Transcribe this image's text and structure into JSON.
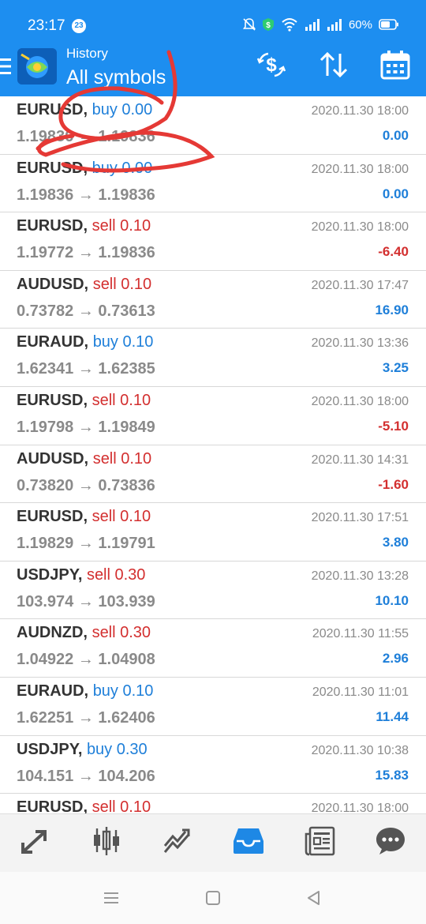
{
  "status_bar": {
    "time": "23:17",
    "notification_count": "23",
    "battery": "60%"
  },
  "header": {
    "subtitle": "History",
    "title": "All symbols",
    "icons": [
      "menu-icon",
      "app-logo",
      "currency-exchange-icon",
      "sort-icon",
      "calendar-icon"
    ]
  },
  "colors": {
    "appbar": "#1d8ef0",
    "buy": "#1e7fd9",
    "sell": "#d32f2f",
    "annotation": "#e53935"
  },
  "deals": [
    {
      "symbol": "EURUSD,",
      "side": "buy",
      "volume": "buy 0.00",
      "prices": "1.19836 → 1.19836",
      "time": "2020.11.30 18:00",
      "profit": "0.00",
      "sign": "pos"
    },
    {
      "symbol": "EURUSD,",
      "side": "buy",
      "volume": "buy 0.00",
      "prices": "1.19836 → 1.19836",
      "time": "2020.11.30 18:00",
      "profit": "0.00",
      "sign": "pos"
    },
    {
      "symbol": "EURUSD,",
      "side": "sell",
      "volume": "sell 0.10",
      "prices": "1.19772 → 1.19836",
      "time": "2020.11.30 18:00",
      "profit": "-6.40",
      "sign": "neg"
    },
    {
      "symbol": "AUDUSD,",
      "side": "sell",
      "volume": "sell 0.10",
      "prices": "0.73782 → 0.73613",
      "time": "2020.11.30 17:47",
      "profit": "16.90",
      "sign": "pos"
    },
    {
      "symbol": "EURAUD,",
      "side": "buy",
      "volume": "buy 0.10",
      "prices": "1.62341 → 1.62385",
      "time": "2020.11.30 13:36",
      "profit": "3.25",
      "sign": "pos"
    },
    {
      "symbol": "EURUSD,",
      "side": "sell",
      "volume": "sell 0.10",
      "prices": "1.19798 → 1.19849",
      "time": "2020.11.30 18:00",
      "profit": "-5.10",
      "sign": "neg"
    },
    {
      "symbol": "AUDUSD,",
      "side": "sell",
      "volume": "sell 0.10",
      "prices": "0.73820 → 0.73836",
      "time": "2020.11.30 14:31",
      "profit": "-1.60",
      "sign": "neg"
    },
    {
      "symbol": "EURUSD,",
      "side": "sell",
      "volume": "sell 0.10",
      "prices": "1.19829 → 1.19791",
      "time": "2020.11.30 17:51",
      "profit": "3.80",
      "sign": "pos"
    },
    {
      "symbol": "USDJPY,",
      "side": "sell",
      "volume": "sell 0.30",
      "prices": "103.974 → 103.939",
      "time": "2020.11.30 13:28",
      "profit": "10.10",
      "sign": "pos"
    },
    {
      "symbol": "AUDNZD,",
      "side": "sell",
      "volume": "sell 0.30",
      "prices": "1.04922 → 1.04908",
      "time": "2020.11.30 11:55",
      "profit": "2.96",
      "sign": "pos"
    },
    {
      "symbol": "EURAUD,",
      "side": "buy",
      "volume": "buy 0.10",
      "prices": "1.62251 → 1.62406",
      "time": "2020.11.30 11:01",
      "profit": "11.44",
      "sign": "pos"
    },
    {
      "symbol": "USDJPY,",
      "side": "buy",
      "volume": "buy 0.30",
      "prices": "104.151 → 104.206",
      "time": "2020.11.30 10:38",
      "profit": "15.83",
      "sign": "pos"
    },
    {
      "symbol": "EURUSD,",
      "side": "sell",
      "volume": "sell 0.10",
      "prices": "",
      "time": "2020.11.30 18:00",
      "profit": "",
      "sign": "pos"
    }
  ],
  "bottom_nav": [
    "quotes-icon",
    "chart-icon",
    "trade-icon",
    "history-icon",
    "news-icon",
    "chat-icon"
  ],
  "system_nav": [
    "recent-apps-icon",
    "home-icon",
    "back-icon"
  ]
}
